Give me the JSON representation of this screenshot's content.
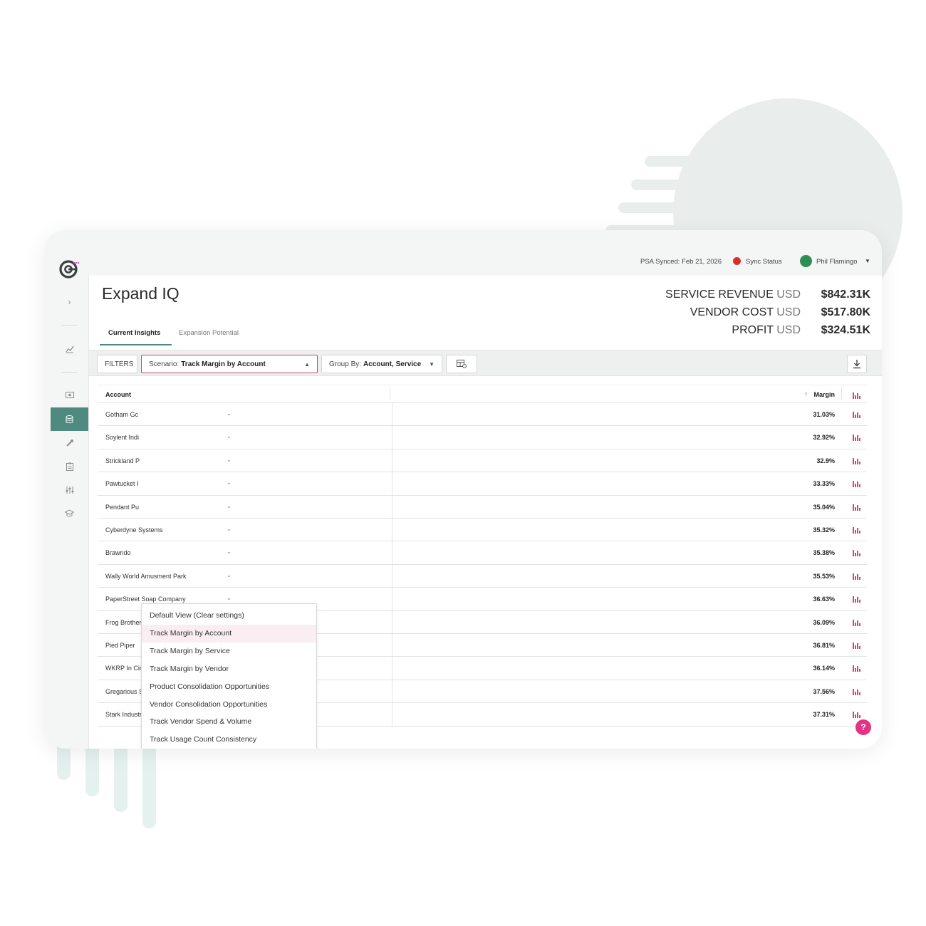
{
  "topbar": {
    "sync_date": "PSA Synced: Feb 21, 2026",
    "sync_status": "Sync Status",
    "user_name": "Phil Flamingo"
  },
  "page": {
    "title": "Expand IQ"
  },
  "metrics": [
    {
      "label": "SERVICE REVENUE",
      "unit": "USD",
      "value": "$842.31K"
    },
    {
      "label": "VENDOR COST",
      "unit": "USD",
      "value": "$517.80K"
    },
    {
      "label": "PROFIT",
      "unit": "USD",
      "value": "$324.51K"
    }
  ],
  "tabs": [
    {
      "label": "Current Insights",
      "active": true
    },
    {
      "label": "Expansion Potential",
      "active": false
    }
  ],
  "toolbar": {
    "filters_label": "FILTERS",
    "scenario_prefix": "Scenario:",
    "scenario_value": "Track Margin by Account",
    "group_prefix": "Group By:",
    "group_value": "Account, Service"
  },
  "scenario_options": [
    "Default View (Clear settings)",
    "Track Margin by Account",
    "Track Margin by Service",
    "Track Margin by Vendor",
    "Product Consolidation Opportunities",
    "Vendor Consolidation Opportunities",
    "Track Vendor Spend & Volume",
    "Track Usage Count Consistency"
  ],
  "scenario_selected_index": 1,
  "table": {
    "headers": {
      "account": "Account",
      "margin": "Margin"
    },
    "rows": [
      {
        "account": "Gotham Gc",
        "margin": "31.03%"
      },
      {
        "account": "Soylent Indi",
        "margin": "32.92%"
      },
      {
        "account": "Strickland P",
        "margin": "32.9%"
      },
      {
        "account": "Pawtucket I",
        "margin": "33.33%"
      },
      {
        "account": "Pendant Pu",
        "margin": "35.04%"
      },
      {
        "account": "Cyberdyne Systems",
        "margin": "35.32%"
      },
      {
        "account": "Brawndo",
        "margin": "35.38%"
      },
      {
        "account": "Wally World Amusment Park",
        "margin": "35.53%"
      },
      {
        "account": "PaperStreet Soap Company",
        "margin": "36.63%"
      },
      {
        "account": "Frog Brothers Comic Shop",
        "margin": "36.09%"
      },
      {
        "account": "Pied Piper",
        "margin": "36.81%"
      },
      {
        "account": "WKRP In Cincinnati",
        "margin": "36.14%"
      },
      {
        "account": "Gregarious Simulation Systems",
        "margin": "37.56%"
      },
      {
        "account": "Stark Industries",
        "margin": "37.31%"
      }
    ]
  },
  "help_label": "?",
  "colors": {
    "accent_teal": "#4e8a80",
    "accent_pink": "#d6457a",
    "status_red": "#d9302c"
  },
  "icons": {
    "rail": [
      "logo-icon",
      "expand-chevron-icon",
      "analytics-icon",
      "money-icon",
      "database-icon",
      "tools-icon",
      "clipboard-icon",
      "sliders-icon",
      "graduation-cap-icon"
    ],
    "row_action": "bar-chart-icon",
    "export": "download-icon",
    "table_settings": "table-settings-icon"
  }
}
